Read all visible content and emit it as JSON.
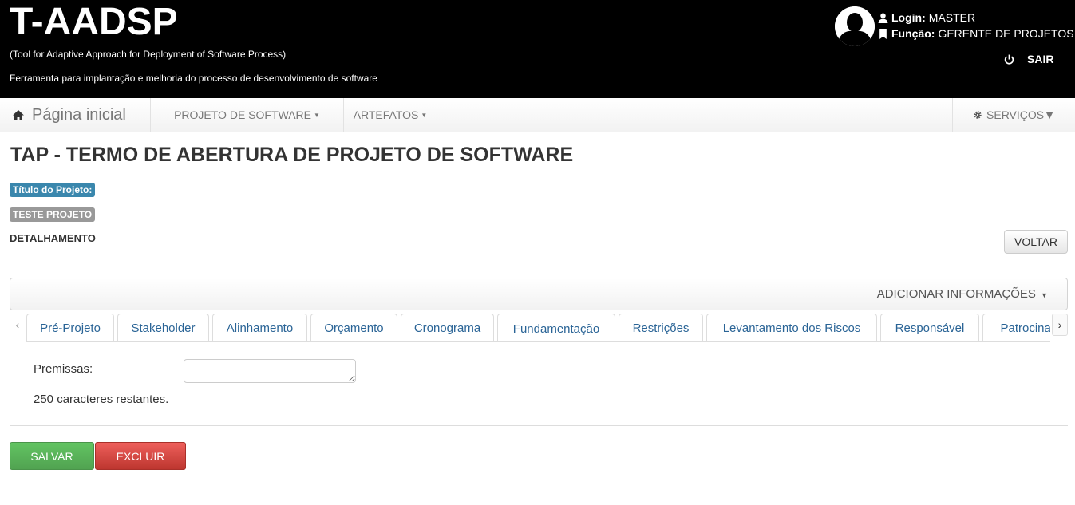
{
  "header": {
    "title": "T-AADSP",
    "subtitle_en": "(Tool for Adaptive Approach for Deployment of Software Process)",
    "subtitle_pt": "Ferramenta para implantação e melhoria do processo de desenvolvimento de software",
    "login_label": "Login:",
    "login_value": "MASTER",
    "role_label": "Função:",
    "role_value": "GERENTE DE PROJETOS",
    "logout_label": "SAIR"
  },
  "navbar": {
    "home_label": "Página inicial",
    "items": [
      {
        "label": "PROJETO DE SOFTWARE"
      },
      {
        "label": "ARTEFATOS"
      }
    ],
    "services_label": "SERVIÇOS"
  },
  "page": {
    "title": "TAP - TERMO DE ABERTURA DE PROJETO DE SOFTWARE",
    "project_title_label": "Título do Projeto:",
    "project_title_value": "TESTE PROJETO",
    "section_label": "DETALHAMENTO",
    "back_button": "VOLTAR",
    "add_info_label": "ADICIONAR INFORMAÇÕES"
  },
  "tabs": {
    "items": [
      {
        "label": "Pré-Projeto"
      },
      {
        "label": "Stakeholder"
      },
      {
        "label": "Alinhamento"
      },
      {
        "label": "Orçamento"
      },
      {
        "label": "Cronograma"
      },
      {
        "label": "Fundamentação",
        "active": true
      },
      {
        "label": "Restrições"
      },
      {
        "label": "Levantamento dos Riscos"
      },
      {
        "label": "Responsável"
      },
      {
        "label": "Patrocinador"
      }
    ],
    "scroll_left_icon": "chevron-left-icon",
    "scroll_right_icon": "chevron-right-icon"
  },
  "form": {
    "premissas_label": "Premissas:",
    "premissas_value": "",
    "remaining_text": "250 caracteres restantes."
  },
  "actions": {
    "save_label": "SALVAR",
    "delete_label": "EXCLUIR"
  },
  "colors": {
    "header_bg": "#000000",
    "info_badge": "#3a87ad",
    "gray_badge": "#999999",
    "save_green": "#5bb75b",
    "delete_red": "#da4f49",
    "link_blue": "#2a6496"
  }
}
